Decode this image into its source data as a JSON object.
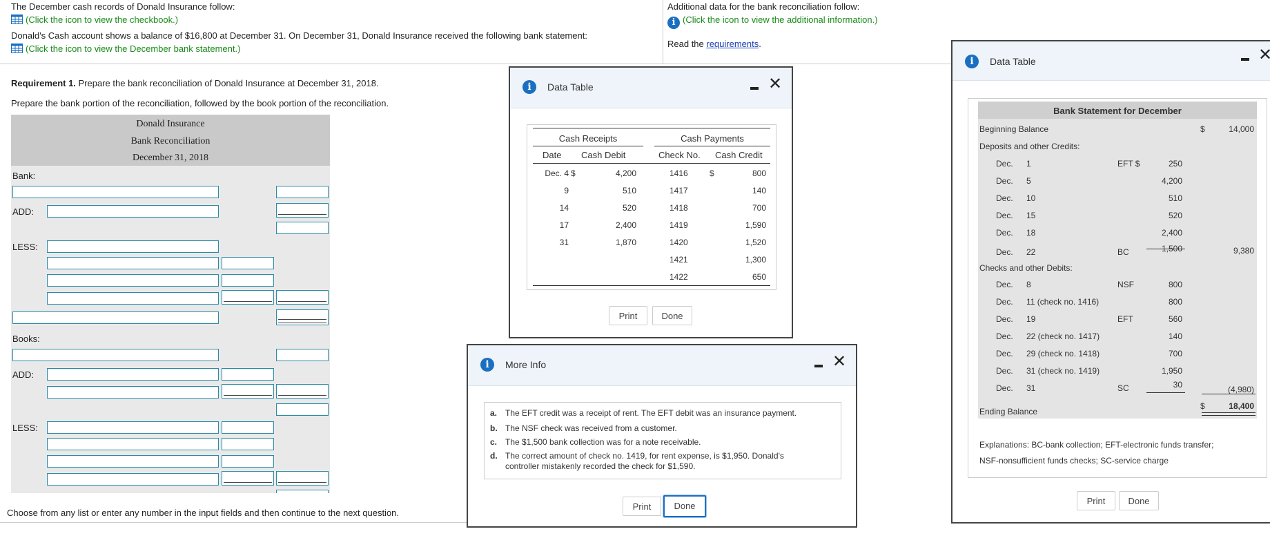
{
  "top": {
    "left": {
      "line1": "The December cash records of Donald Insurance follow:",
      "checkbook_link": "(Click the icon to view the checkbook.)",
      "line2": "Donald's Cash account shows a balance of $16,800 at December 31. On December 31, Donald Insurance received the following bank statement:",
      "statement_link": "(Click the icon to view the December bank statement.)"
    },
    "right": {
      "line1": "Additional data for the bank reconciliation follow:",
      "info_link": "(Click the icon to view the additional information.)",
      "read_prefix": "Read the ",
      "requirements_link": "requirements",
      "read_suffix": "."
    }
  },
  "requirement": {
    "bold": "Requirement 1.",
    "text": " Prepare the bank reconciliation of Donald Insurance at December 31, 2018.",
    "sub": "Prepare the bank portion of the reconciliation, followed by the book portion of the reconciliation."
  },
  "worksheet": {
    "company": "Donald Insurance",
    "title": "Bank Reconciliation",
    "date": "December 31, 2018",
    "bank_label": "Bank:",
    "add_label": "ADD:",
    "less_label": "LESS:",
    "books_label": "Books:"
  },
  "footer_text": "Choose from any list or enter any number in the input fields and then continue to the next question.",
  "checkbook_dialog": {
    "title": "Data Table",
    "receipts_header": "Cash Receipts",
    "payments_header": "Cash Payments",
    "col_date": "Date",
    "col_debit": "Cash Debit",
    "col_check": "Check No.",
    "col_credit": "Cash Credit",
    "receipts": [
      {
        "date": "Dec. 4",
        "cur": "$",
        "amount": "4,200"
      },
      {
        "date": "9",
        "cur": "",
        "amount": "510"
      },
      {
        "date": "14",
        "cur": "",
        "amount": "520"
      },
      {
        "date": "17",
        "cur": "",
        "amount": "2,400"
      },
      {
        "date": "31",
        "cur": "",
        "amount": "1,870"
      }
    ],
    "payments": [
      {
        "check": "1416",
        "cur": "$",
        "amount": "800"
      },
      {
        "check": "1417",
        "cur": "",
        "amount": "140"
      },
      {
        "check": "1418",
        "cur": "",
        "amount": "700"
      },
      {
        "check": "1419",
        "cur": "",
        "amount": "1,590"
      },
      {
        "check": "1420",
        "cur": "",
        "amount": "1,520"
      },
      {
        "check": "1421",
        "cur": "",
        "amount": "1,300"
      },
      {
        "check": "1422",
        "cur": "",
        "amount": "650"
      }
    ],
    "print_label": "Print",
    "done_label": "Done"
  },
  "info_dialog": {
    "title": "More Info",
    "items": [
      {
        "letter": "a.",
        "text": "The EFT credit was a receipt of rent. The EFT debit was an insurance payment."
      },
      {
        "letter": "b.",
        "text": "The NSF check was received from a customer."
      },
      {
        "letter": "c.",
        "text": "The $1,500 bank collection was for a note receivable."
      },
      {
        "letter": "d.",
        "text": "The correct amount of check no. 1419, for rent expense, is $1,950. Donald's",
        "text2": "controller mistakenly recorded the check for $1,590."
      }
    ],
    "print_label": "Print",
    "done_label": "Done"
  },
  "statement_dialog": {
    "title": "Data Table",
    "header": "Bank Statement for December",
    "beginning_label": "Beginning Balance",
    "beginning_cur": "$",
    "beginning_amount": "14,000",
    "deposits_label": "Deposits and other Credits:",
    "deposits": [
      {
        "mo": "Dec.",
        "day": "1",
        "code": "EFT $",
        "amount": "250"
      },
      {
        "mo": "Dec.",
        "day": "5",
        "code": "",
        "amount": "4,200"
      },
      {
        "mo": "Dec.",
        "day": "10",
        "code": "",
        "amount": "510"
      },
      {
        "mo": "Dec.",
        "day": "15",
        "code": "",
        "amount": "520"
      },
      {
        "mo": "Dec.",
        "day": "18",
        "code": "",
        "amount": "2,400"
      },
      {
        "mo": "Dec.",
        "day": "22",
        "code": "BC",
        "amount": "1,500"
      }
    ],
    "deposits_total": "9,380",
    "checks_label": "Checks and other Debits:",
    "checks": [
      {
        "mo": "Dec.",
        "day": "8",
        "code": "NSF",
        "amount": "800"
      },
      {
        "mo": "Dec.",
        "day": "11 (check no. 1416)",
        "code": "",
        "amount": "800"
      },
      {
        "mo": "Dec.",
        "day": "19",
        "code": "EFT",
        "amount": "560"
      },
      {
        "mo": "Dec.",
        "day": "22 (check no. 1417)",
        "code": "",
        "amount": "140"
      },
      {
        "mo": "Dec.",
        "day": "29 (check no. 1418)",
        "code": "",
        "amount": "700"
      },
      {
        "mo": "Dec.",
        "day": "31 (check no. 1419)",
        "code": "",
        "amount": "1,950"
      },
      {
        "mo": "Dec.",
        "day": "31",
        "code": "SC",
        "amount": "30"
      }
    ],
    "checks_total": "(4,980)",
    "ending_label": "Ending Balance",
    "ending_cur": "$",
    "ending_amount": "18,400",
    "explanations_1": "Explanations: BC-bank collection; EFT-electronic funds transfer;",
    "explanations_2": "NSF-nonsufficient funds checks; SC-service charge",
    "print_label": "Print",
    "done_label": "Done"
  }
}
